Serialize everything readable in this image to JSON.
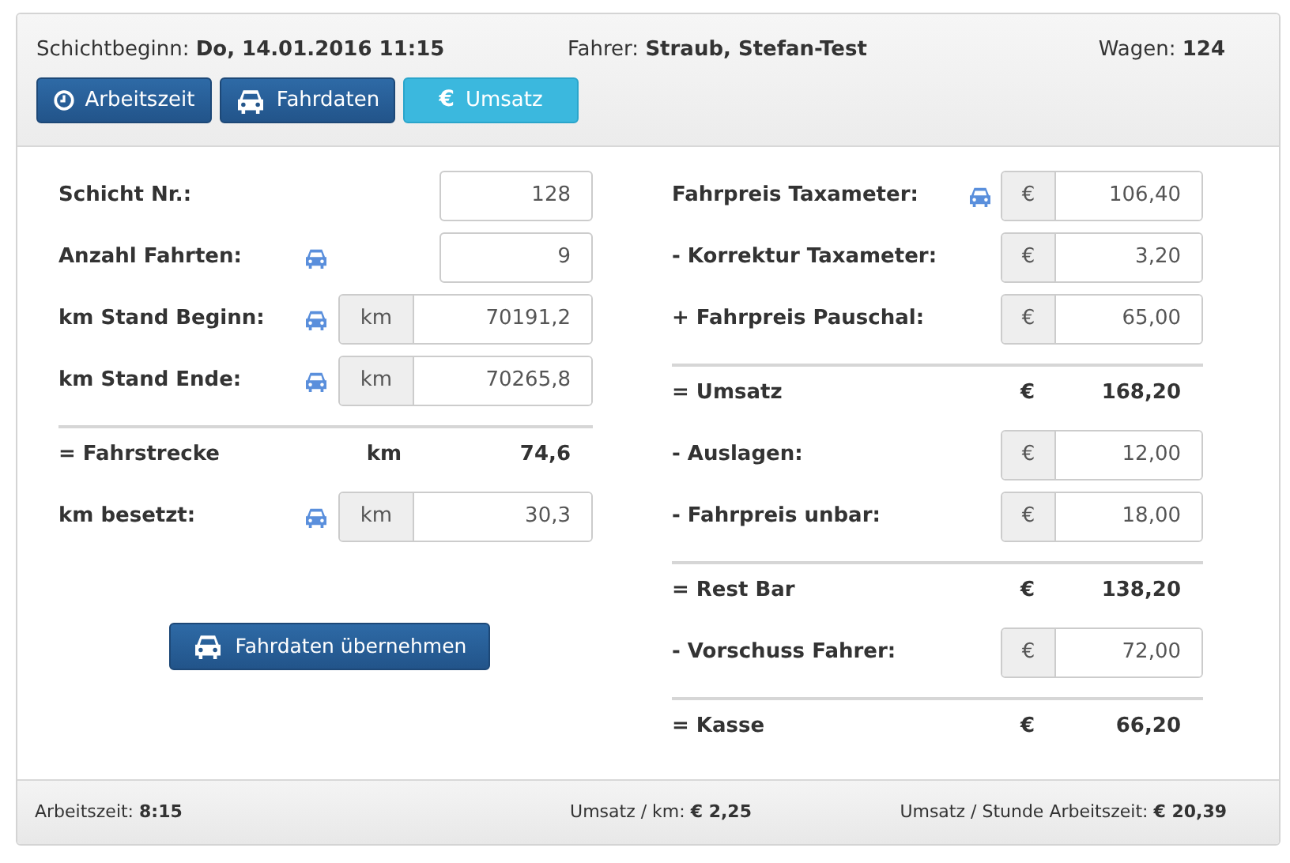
{
  "header": {
    "shift_start": {
      "label": "Schichtbeginn:",
      "value": "Do, 14.01.2016 11:15"
    },
    "driver": {
      "label": "Fahrer:",
      "value": "Straub, Stefan-Test"
    },
    "car": {
      "label": "Wagen:",
      "value": "124"
    }
  },
  "tabs": [
    {
      "label": "Arbeitszeit",
      "selected": false
    },
    {
      "label": "Fahrdaten",
      "selected": false
    },
    {
      "label": "Umsatz",
      "symbol": "€",
      "selected": true
    }
  ],
  "left_rows": [
    {
      "kind": "input",
      "label": "Schicht Nr.:",
      "taxi": false,
      "value": "128"
    },
    {
      "kind": "input",
      "label": "Anzahl Fahrten:",
      "taxi": true,
      "value": "9"
    },
    {
      "kind": "input",
      "label": "km Stand Beginn:",
      "taxi": true,
      "unit": "km",
      "value": "70191,2"
    },
    {
      "kind": "input",
      "label": "km Stand Ende:",
      "taxi": true,
      "unit": "km",
      "value": "70265,8"
    },
    {
      "kind": "total",
      "label": "= Fahrstrecke",
      "unit": "km",
      "value": "74,6"
    },
    {
      "kind": "input",
      "label": "km besetzt:",
      "taxi": true,
      "unit": "km",
      "value": "30,3"
    }
  ],
  "apply_button": {
    "label": "Fahrdaten übernehmen"
  },
  "right_rows": [
    {
      "kind": "input",
      "label": "Fahrpreis Taxameter:",
      "taxi": true,
      "unit": "€",
      "value": "106,40"
    },
    {
      "kind": "input",
      "label": "- Korrektur Taxameter:",
      "taxi": false,
      "unit": "€",
      "value": "3,20"
    },
    {
      "kind": "input",
      "label": "+ Fahrpreis Pauschal:",
      "taxi": false,
      "unit": "€",
      "value": "65,00"
    },
    {
      "kind": "total",
      "label": "= Umsatz",
      "unit": "€",
      "value": "168,20"
    },
    {
      "kind": "input",
      "label": "- Auslagen:",
      "taxi": false,
      "unit": "€",
      "value": "12,00"
    },
    {
      "kind": "input",
      "label": "- Fahrpreis unbar:",
      "taxi": false,
      "unit": "€",
      "value": "18,00"
    },
    {
      "kind": "total",
      "label": "= Rest Bar",
      "unit": "€",
      "value": "138,20"
    },
    {
      "kind": "input",
      "label": "- Vorschuss Fahrer:",
      "taxi": false,
      "unit": "€",
      "value": "72,00"
    },
    {
      "kind": "total",
      "label": "= Kasse",
      "unit": "€",
      "value": "66,20"
    }
  ],
  "footer": [
    {
      "label": "Arbeitszeit:",
      "value": "8:15"
    },
    {
      "label": "Umsatz / km:",
      "value": "€ 2,25"
    },
    {
      "label": "Umsatz / Stunde Arbeitszeit:",
      "value": "€ 20,39"
    }
  ]
}
